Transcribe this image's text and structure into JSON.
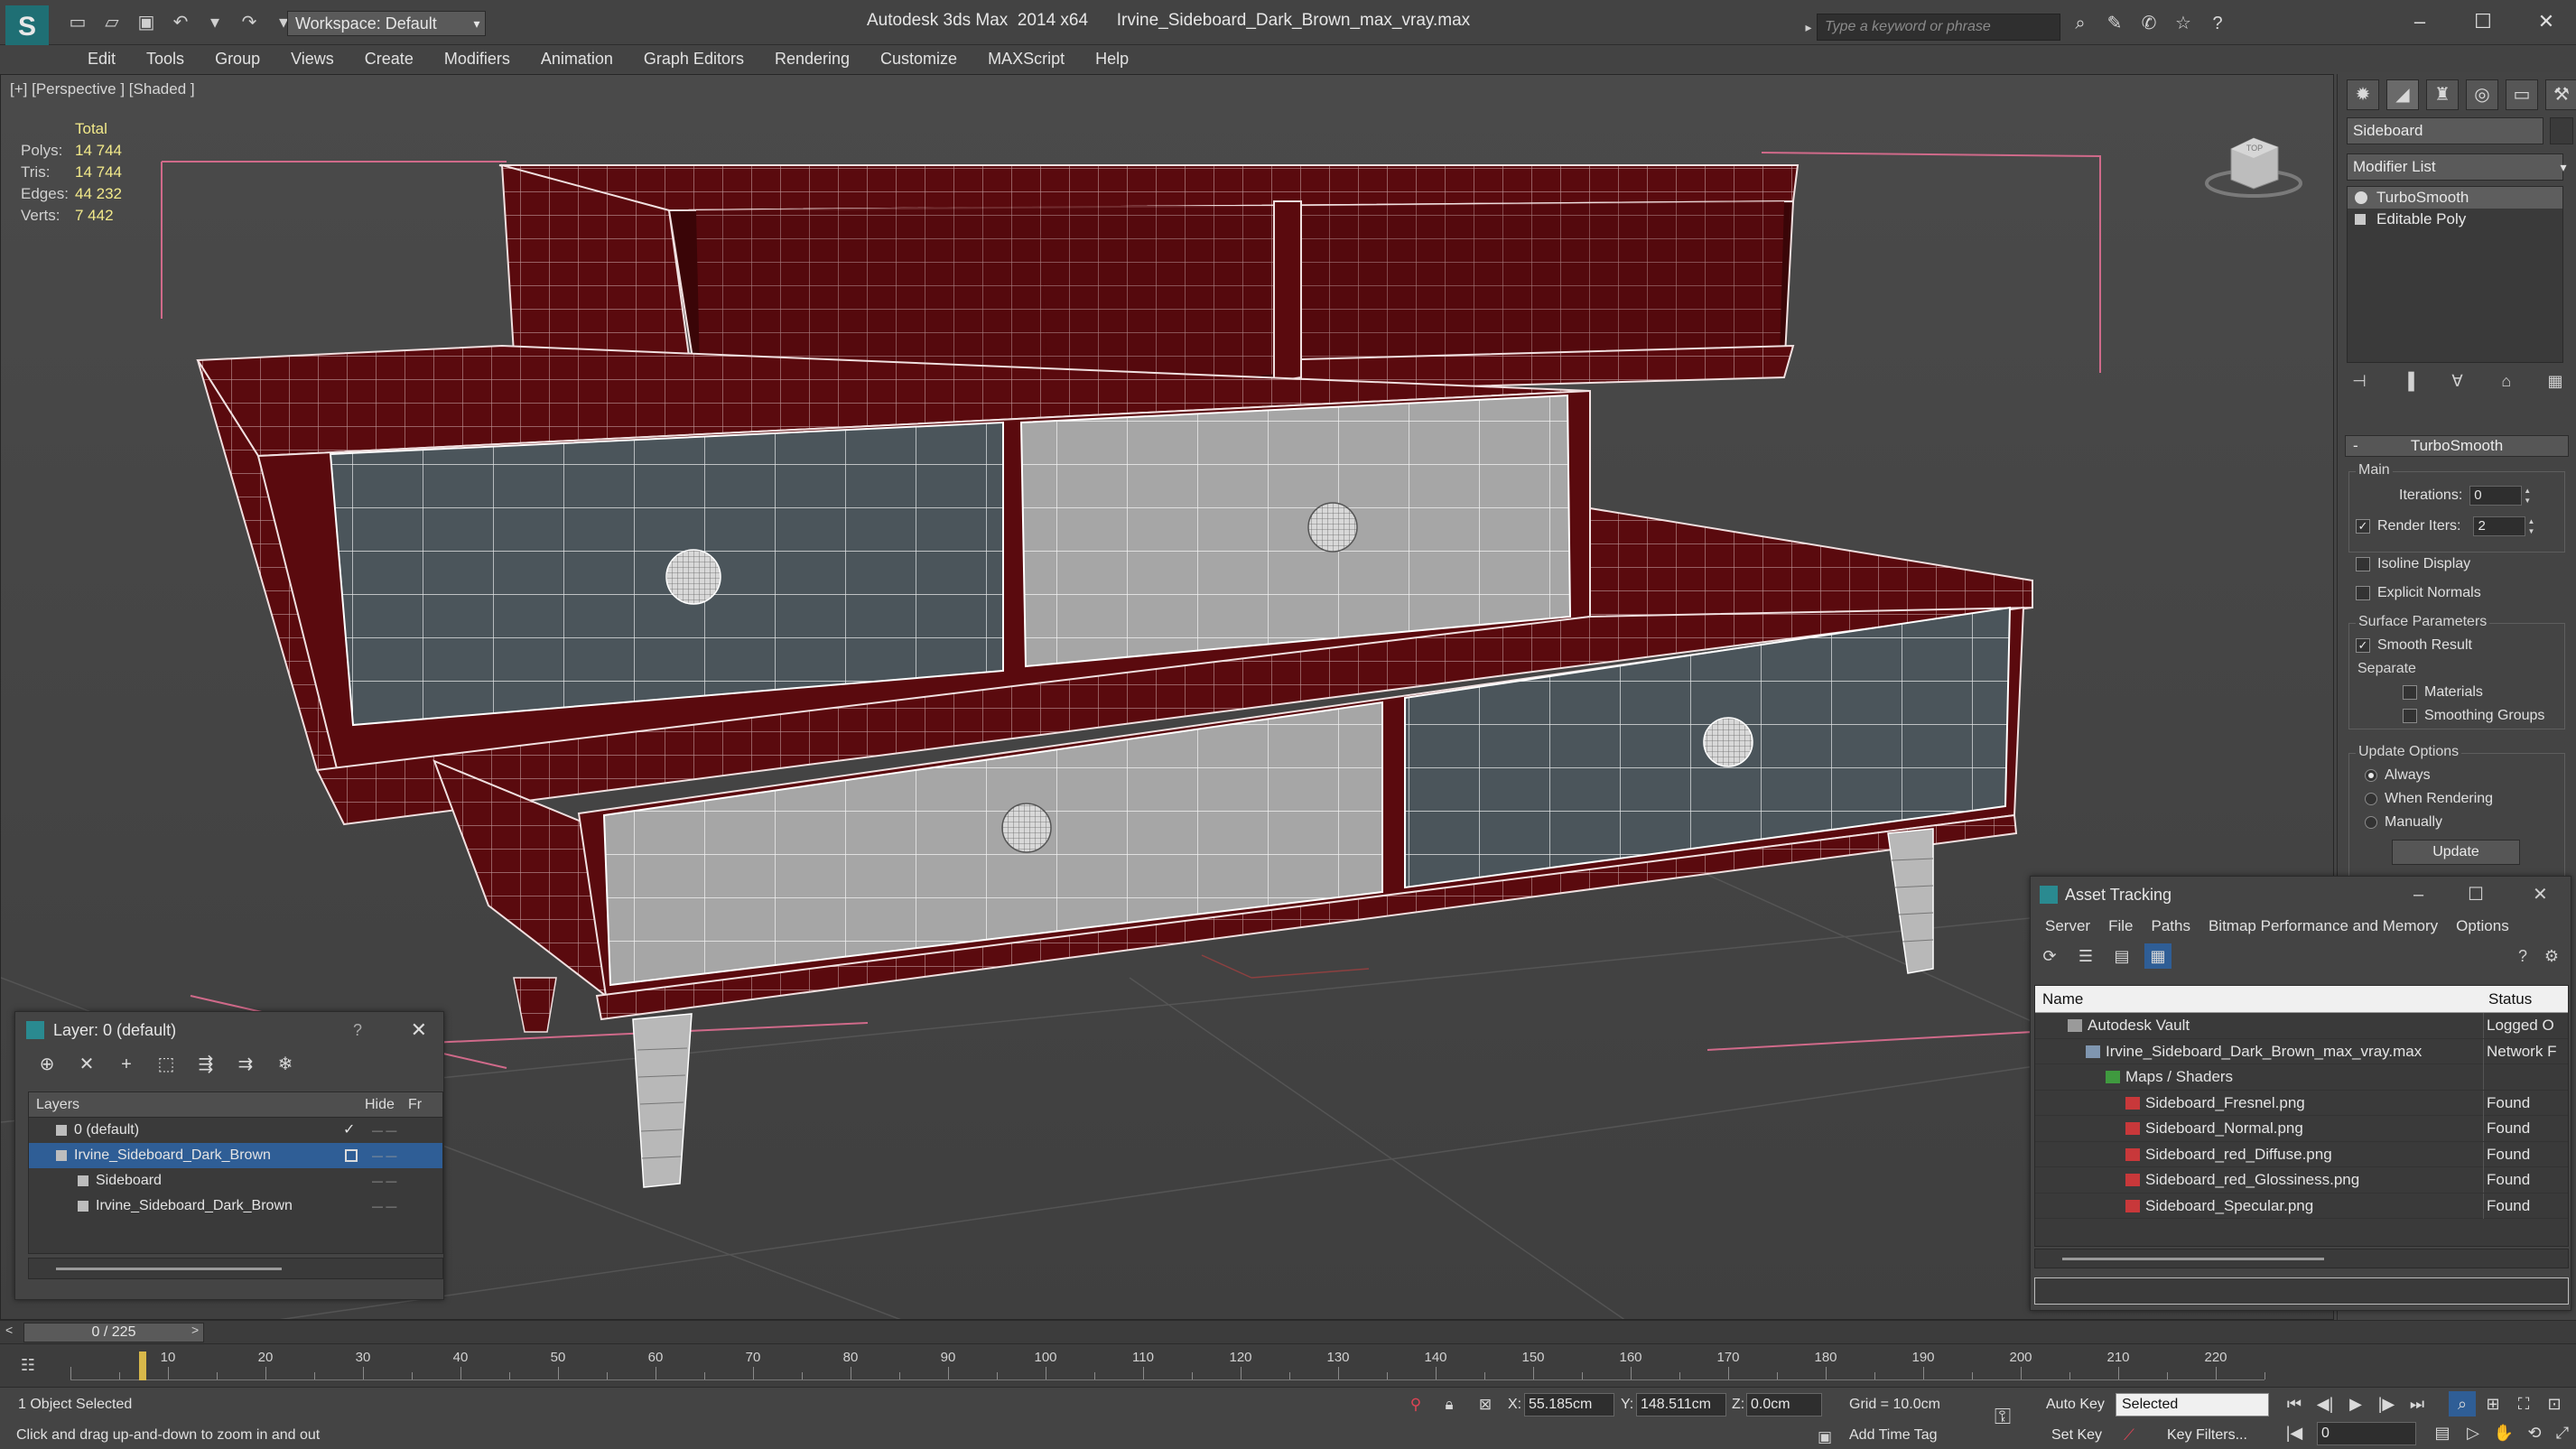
{
  "window": {
    "title": "Autodesk 3ds Max  2014 x64      Irvine_Sideboard_Dark_Brown_max_vray.max",
    "workspace": "Workspace: Default",
    "search_placeholder": "Type a keyword or phrase"
  },
  "menu": [
    "Edit",
    "Tools",
    "Group",
    "Views",
    "Create",
    "Modifiers",
    "Animation",
    "Graph Editors",
    "Rendering",
    "Customize",
    "MAXScript",
    "Help"
  ],
  "viewport": {
    "label": "[+] [Perspective ] [Shaded ]",
    "stats": {
      "total_label": "Total",
      "rows": [
        {
          "k": "Polys:",
          "v": "14 744"
        },
        {
          "k": "Tris:",
          "v": "14 744"
        },
        {
          "k": "Edges:",
          "v": "44 232"
        },
        {
          "k": "Verts:",
          "v": "7 442"
        }
      ]
    },
    "viewcube_label": "TOP"
  },
  "command_panel": {
    "object_name": "Sideboard",
    "modifier_list": "Modifier List",
    "stack": [
      "TurboSmooth",
      "Editable Poly"
    ],
    "rollout_title": "TurboSmooth",
    "main_label": "Main",
    "iterations_label": "Iterations:",
    "iterations_value": "0",
    "render_iters_label": "Render Iters:",
    "render_iters_value": "2",
    "isoline": "Isoline Display",
    "explicit_normals": "Explicit Normals",
    "surface_params": "Surface Parameters",
    "smooth_result": "Smooth Result",
    "separate": "Separate",
    "materials": "Materials",
    "smoothing_groups": "Smoothing Groups",
    "update_options": "Update Options",
    "always": "Always",
    "when_rendering": "When Rendering",
    "manually": "Manually",
    "update_button": "Update"
  },
  "layer_dialog": {
    "title": "Layer: 0 (default)",
    "help": "?",
    "columns": {
      "layers": "Layers",
      "hide": "Hide",
      "freeze": "Fr"
    },
    "rows": [
      {
        "name": "0 (default)",
        "indent": 0
      },
      {
        "name": "Irvine_Sideboard_Dark_Brown",
        "indent": 0
      },
      {
        "name": "Sideboard",
        "indent": 1
      },
      {
        "name": "Irvine_Sideboard_Dark_Brown",
        "indent": 1
      }
    ]
  },
  "asset_tracking": {
    "title": "Asset Tracking",
    "menu": [
      "Server",
      "File",
      "Paths",
      "Bitmap Performance and Memory",
      "Options"
    ],
    "columns": {
      "name": "Name",
      "status": "Status"
    },
    "rows": [
      {
        "name": "Autodesk Vault",
        "status": "Logged O"
      },
      {
        "name": "Irvine_Sideboard_Dark_Brown_max_vray.max",
        "status": "Network F"
      },
      {
        "name": "Maps / Shaders",
        "status": ""
      },
      {
        "name": "Sideboard_Fresnel.png",
        "status": "Found"
      },
      {
        "name": "Sideboard_Normal.png",
        "status": "Found"
      },
      {
        "name": "Sideboard_red_Diffuse.png",
        "status": "Found"
      },
      {
        "name": "Sideboard_red_Glossiness.png",
        "status": "Found"
      },
      {
        "name": "Sideboard_Specular.png",
        "status": "Found"
      }
    ]
  },
  "timeline": {
    "frame": "0 / 225",
    "ticks": [
      "10",
      "20",
      "30",
      "40",
      "50",
      "60",
      "70",
      "80",
      "90",
      "100",
      "110",
      "120",
      "130",
      "140",
      "150",
      "160",
      "170",
      "180",
      "190",
      "200",
      "210",
      "220"
    ]
  },
  "status": {
    "selection": "1 Object Selected",
    "prompt": "Click and drag up-and-down to zoom in and out",
    "x_label": "X:",
    "x_value": "55.185cm",
    "y_label": "Y:",
    "y_value": "148.511cm",
    "z_label": "Z:",
    "z_value": "0.0cm",
    "grid": "Grid = 10.0cm",
    "add_time_tag": "Add Time Tag",
    "auto_key": "Auto Key",
    "set_key": "Set Key",
    "selected_option": "Selected",
    "key_filters": "Key Filters...",
    "frame_field": "0"
  },
  "colors": {
    "wood": "#5a0a0e",
    "drawer_light": "#a4a4a4",
    "drawer_dark": "#4a5358",
    "wire": "#ffffff",
    "selection_blue": "#2f5e96",
    "stat_yellow": "#f2e98a"
  }
}
